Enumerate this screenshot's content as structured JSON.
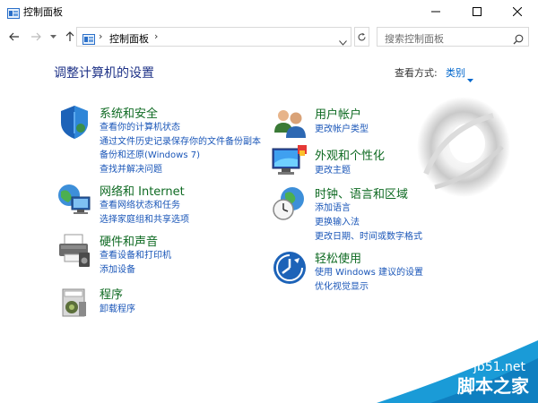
{
  "window": {
    "title": "控制面板",
    "accent_text": "#1e3287",
    "link_color": "#1a56b8",
    "category_color": "#0e6a22"
  },
  "navigation": {
    "address_path": "控制面板",
    "search_placeholder": "搜索控制面板"
  },
  "main": {
    "title": "调整计算机的设置",
    "view_by_label": "查看方式:",
    "view_by_value": "类别"
  },
  "categories": [
    {
      "title": "系统和安全",
      "icon": "shield-icon",
      "links": [
        "查看你的计算机状态",
        "通过文件历史记录保存你的文件备份副本",
        "备份和还原(Windows 7)",
        "查找并解决问题"
      ]
    },
    {
      "title": "网络和 Internet",
      "icon": "network-globe-icon",
      "links": [
        "查看网络状态和任务",
        "选择家庭组和共享选项"
      ]
    },
    {
      "title": "硬件和声音",
      "icon": "printer-icon",
      "links": [
        "查看设备和打印机",
        "添加设备"
      ]
    },
    {
      "title": "程序",
      "icon": "programs-icon",
      "links": [
        "卸载程序"
      ]
    },
    {
      "title": "用户帐户",
      "icon": "users-icon",
      "links": [
        "更改帐户类型"
      ]
    },
    {
      "title": "外观和个性化",
      "icon": "monitor-icon",
      "links": [
        "更改主题"
      ]
    },
    {
      "title": "时钟、语言和区域",
      "icon": "clock-globe-icon",
      "links": [
        "添加语言",
        "更换输入法",
        "更改日期、时间或数字格式"
      ]
    },
    {
      "title": "轻松使用",
      "icon": "accessibility-icon",
      "links": [
        "使用 Windows 建议的设置",
        "优化视觉显示"
      ]
    }
  ],
  "watermark": {
    "site": "jb51.net",
    "name": "脚本之家"
  }
}
